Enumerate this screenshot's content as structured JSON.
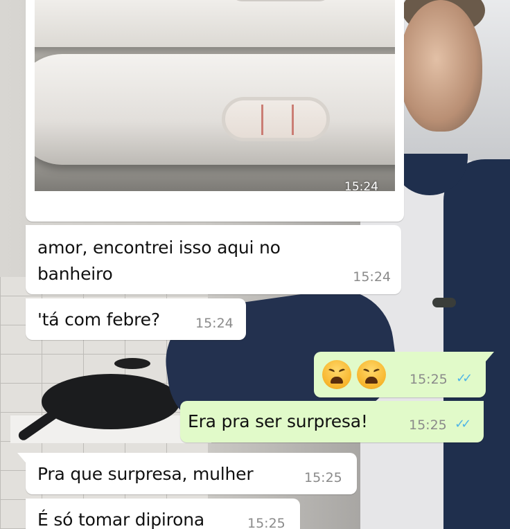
{
  "chat": {
    "image_message": {
      "time": "15:24"
    },
    "messages": [
      {
        "id": "m1",
        "direction": "incoming",
        "text_line1": "amor, encontrei isso aqui no",
        "text_line2": "banheiro",
        "time": "15:24"
      },
      {
        "id": "m2",
        "direction": "incoming",
        "text": "'tá com febre?",
        "time": "15:24"
      },
      {
        "id": "m3",
        "direction": "outgoing",
        "emojis": [
          "weary-face",
          "weary-face"
        ],
        "time": "15:25",
        "status": "read"
      },
      {
        "id": "m4",
        "direction": "outgoing",
        "text": "Era pra ser surpresa!",
        "time": "15:25",
        "status": "read"
      },
      {
        "id": "m5",
        "direction": "incoming",
        "text": "Pra que surpresa, mulher",
        "time": "15:25"
      },
      {
        "id": "m6",
        "direction": "incoming",
        "text": "É só tomar dipirona",
        "time": "15:25"
      }
    ]
  },
  "colors": {
    "incoming_bubble": "#ffffff",
    "outgoing_bubble": "#e1fac9",
    "read_ticks": "#4fb5e6",
    "timestamp": "#8a8a8a"
  }
}
